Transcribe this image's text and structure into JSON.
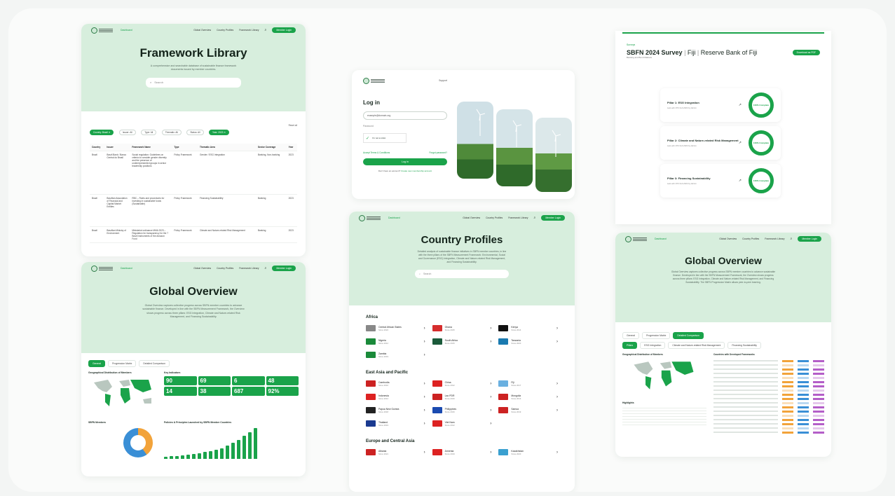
{
  "framework": {
    "nav_links": [
      "Global Overview",
      "Country Profiles",
      "Framework Library"
    ],
    "nav_active": "Dashboard",
    "login": "Member Login",
    "title": "Framework Library",
    "lede": "A comprehensive and searchable database of sustainable finance framework documents issued by member countries.",
    "search": "Search",
    "filters": [
      "Country: Brazil ✕",
      "Issuer: All",
      "Type: All",
      "Thematic: All",
      "Status: All",
      "Year: 2023 ✕"
    ],
    "reset": "Reset all",
    "columns": [
      "Country",
      "Issuer",
      "Framework Name",
      "Type",
      "Thematic Area",
      "Sector Coverage",
      "Year"
    ],
    "rows": [
      {
        "country": "Brazil",
        "issuer": "Brazil Bank / Banco Central do Brasil",
        "name": "Social regulation: Guidelines on criteria to consider gender diversity and the presence of underrepresented groups in senior leadership positions",
        "type": "Policy Framework",
        "thematic": "Gender / ESG Integration",
        "sector": "Banking, Non-banking",
        "year": "2023"
      },
      {
        "country": "Brazil",
        "issuer": "Brazilian Association of Financial and Capital Market Entities",
        "name": "RBC – Rules and procedures for investing in sustainable funds (Sustainable)",
        "type": "Policy Framework",
        "thematic": "Financing Sustainability",
        "sector": "Banking",
        "year": "2023"
      },
      {
        "country": "Brazil",
        "issuer": "Brazilian Ministry of Environment",
        "name": "Ministerial ordinance MMA 2023 – Regulation for transparency for the 7 Brazil instruments of the Amazon Fund",
        "type": "Policy Framework",
        "thematic": "Climate and Nature-related Risk Management",
        "sector": "Banking",
        "year": "2023"
      }
    ]
  },
  "login": {
    "support": "Support",
    "title": "Log in",
    "email": "example@domain.org",
    "password": "Password",
    "recaptcha": "I'm not a robot",
    "accept": "Accept Terms & Conditions",
    "forgot": "Forgot password?",
    "button": "Log in",
    "footer": "Don't have an account?",
    "footer_link": "Create new membership account"
  },
  "survey": {
    "eyebrow": "Surveys",
    "title": "SBFN 2024 Survey",
    "country": "Fiji",
    "issuer": "Reserve Bank of Fiji",
    "sub": "Banking and Bond Markets",
    "download": "Download as PDF",
    "pillars": [
      {
        "name": "Pillar 1: ESG Integration",
        "sub": "Last edit 17th Feb 2024 by Admin",
        "pct": "100% Complete"
      },
      {
        "name": "Pillar 2: Climate and Nature-related Risk Management",
        "sub": "Last edit 17th Feb 2024 by Admin",
        "pct": "100% Complete"
      },
      {
        "name": "Pillar 3: Financing Sustainability",
        "sub": "Last edit 17th Feb 2024 by Admin",
        "pct": "100% Complete"
      }
    ]
  },
  "global": {
    "title": "Global Overview",
    "lede": "Global Overview captures collective progress across SBFN member countries to advance sustainable finance. Developed in line with the SBFN Measurement Framework, the Overview shows progress across three pillars: ESG Integration, Climate and Nature-related Risk Management, and Financing Sustainability.",
    "tabs": [
      "General",
      "Progression Matrix",
      "Detailed Comparison"
    ],
    "map_title": "Geographical Distribution of Members",
    "key_title": "Key Indicators",
    "kpis": [
      "90",
      "69",
      "6",
      "48",
      "14",
      "38",
      "687",
      "92%"
    ],
    "membership": "SBFN Members",
    "policies": "Policies & Principles Launched by SBFN Member Countries",
    "bars": [
      3,
      4,
      4,
      5,
      6,
      7,
      8,
      10,
      12,
      14,
      16,
      20,
      24,
      28,
      34,
      40,
      46
    ],
    "pillars": [
      "Pillars",
      "ESG Integration",
      "Climate and Nature-related Risk Management",
      "Financing Sustainability"
    ],
    "highlights": "Highlights"
  },
  "country": {
    "title": "Country Profiles",
    "lede": "Detailed analysis of sustainable finance initiatives in SBFN member countries, in line with the three pillars of the SBFN Measurement Framework: Environmental, Social and Governance (ESG) Integration, Climate and Nature-related Risk Management, and Financing Sustainability.",
    "search": "Search",
    "regions": [
      {
        "name": "Africa",
        "items": [
          {
            "n": "Central African States",
            "s": "Since 2022",
            "c": "#888"
          },
          {
            "n": "Ghana",
            "s": "Since 2015",
            "c": "#d62d2d"
          },
          {
            "n": "Kenya",
            "s": "Since 2014",
            "c": "#111"
          },
          {
            "n": "Nigeria",
            "s": "Since 2012",
            "c": "#1a8a3a"
          },
          {
            "n": "South Africa",
            "s": "Since 2015",
            "c": "#1a5a3a"
          },
          {
            "n": "Tanzania",
            "s": "Since 2020",
            "c": "#1a7ab0"
          },
          {
            "n": "Zambia",
            "s": "Since 2019",
            "c": "#1a8a3a"
          }
        ]
      },
      {
        "name": "East Asia and Pacific",
        "items": [
          {
            "n": "Cambodia",
            "s": "Since 2016",
            "c": "#c22"
          },
          {
            "n": "China",
            "s": "Since 2012",
            "c": "#d22"
          },
          {
            "n": "Fiji",
            "s": "Since 2017",
            "c": "#6ab0e0"
          },
          {
            "n": "Indonesia",
            "s": "Since 2012",
            "c": "#d22"
          },
          {
            "n": "Lao PDR",
            "s": "Since 2016",
            "c": "#c22"
          },
          {
            "n": "Mongolia",
            "s": "Since 2013",
            "c": "#c22"
          },
          {
            "n": "Papua New Guinea",
            "s": "Since 2018",
            "c": "#222"
          },
          {
            "n": "Philippines",
            "s": "Since 2016",
            "c": "#1a4ab0"
          },
          {
            "n": "Samoa",
            "s": "Since 2019",
            "c": "#c22"
          },
          {
            "n": "Thailand",
            "s": "Since 2019",
            "c": "#1a3a90"
          },
          {
            "n": "Viet Nam",
            "s": "Since 2012",
            "c": "#d22"
          }
        ]
      },
      {
        "name": "Europe and Central Asia",
        "items": [
          {
            "n": "Albania",
            "s": "Since 2021",
            "c": "#c22"
          },
          {
            "n": "Armenia",
            "s": "Since 2019",
            "c": "#d22"
          },
          {
            "n": "Kazakhstan",
            "s": "Since 2020",
            "c": "#3aa0d0"
          }
        ]
      }
    ]
  },
  "global2": {
    "title": "Global Overview",
    "lede": "Global Overview captures collective progress across SBFN member countries to advance sustainable finance. Developed in line with the SBFN Measurement Framework, the Overview shows progress across three pillars: ESG Integration, Climate and Nature-related Risk Management, and Financing Sustainability. The SBFN Progression Matrix allows peer-to-peer learning.",
    "tabs": [
      "General",
      "Progression Matrix",
      "Detailed Comparison"
    ],
    "countries_title": "Countries with Developed Frameworks",
    "highlights": "Highlights"
  }
}
